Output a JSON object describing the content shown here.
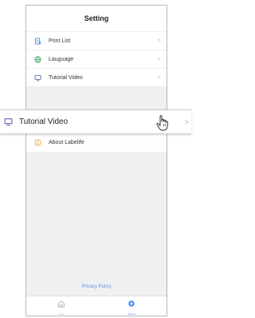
{
  "header": {
    "title": "Setting"
  },
  "menu": {
    "items": [
      {
        "label": "Print List",
        "icon": "print-list-icon",
        "color": "#3f8ce6"
      },
      {
        "label": "Lauguage",
        "icon": "globe-icon",
        "color": "#36a860"
      },
      {
        "label": "Tutorial Video",
        "icon": "monitor-icon",
        "color": "#5a6aa0"
      }
    ],
    "about": {
      "label": "About Labelife",
      "icon": "info-icon",
      "color": "#f0a020"
    }
  },
  "zoom_row": {
    "label": "Tutorial Video",
    "icon": "monitor-icon",
    "color": "#6a5fb0"
  },
  "footer": {
    "privacy": "Privacy Policy"
  },
  "tabbar": {
    "tabs": [
      {
        "label": "Home",
        "icon": "home-icon",
        "active": false
      },
      {
        "label": "Setting",
        "icon": "settings-gear-icon",
        "active": true
      }
    ]
  },
  "chevron": ">",
  "cursor": "hand-pointer-icon"
}
